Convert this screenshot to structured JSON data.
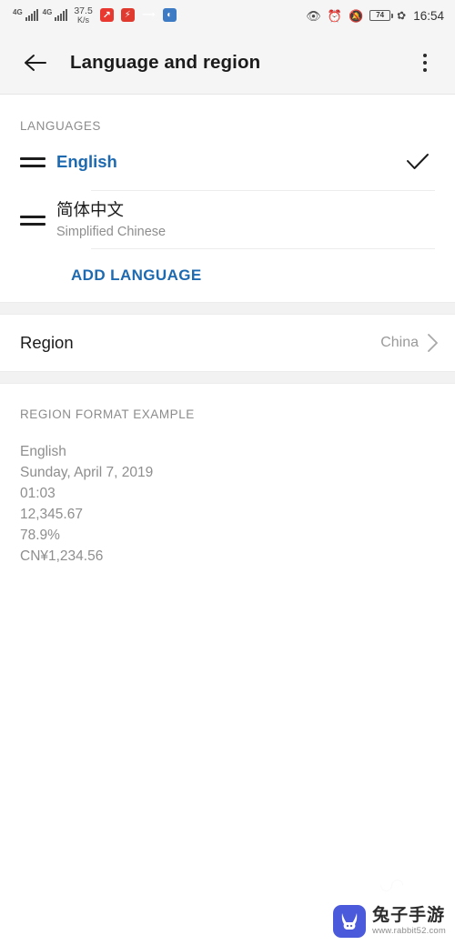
{
  "statusbar": {
    "network_left": [
      {
        "gen": "4G",
        "icon": "signal-bars-icon"
      },
      {
        "gen": "4G",
        "icon": "signal-bars-icon"
      }
    ],
    "net_speed_value": "37.5",
    "net_speed_unit": "K/s",
    "app_icons": [
      "stock-chart-red-icon",
      "stock-alert-red-icon",
      "trend-arrow-red-icon",
      "analytics-blue-icon"
    ],
    "right_icons": [
      "eye-care-icon",
      "alarm-clock-icon",
      "mute-bell-icon"
    ],
    "battery_level": "74",
    "power_saving_icon": "leaf-icon",
    "clock": "16:54"
  },
  "appbar": {
    "back_icon": "back-arrow-icon",
    "title": "Language and region",
    "overflow_icon": "more-vertical-icon"
  },
  "languages_section": {
    "header": "LANGUAGES",
    "items": [
      {
        "handle_icon": "drag-handle-icon",
        "primary": "English",
        "sub": "",
        "selected": true,
        "check_icon": "check-icon"
      },
      {
        "handle_icon": "drag-handle-icon",
        "primary": "简体中文",
        "sub": "Simplified Chinese",
        "selected": false,
        "check_icon": ""
      }
    ],
    "add_language_label": "ADD LANGUAGE"
  },
  "region_section": {
    "label": "Region",
    "value": "China",
    "chevron_icon": "chevron-right-icon"
  },
  "format_section": {
    "header": "REGION FORMAT EXAMPLE",
    "lines": [
      "English",
      "Sunday, April 7, 2019",
      "01:03",
      "12,345.67",
      "78.9%",
      "CN¥1,234.56"
    ]
  },
  "watermark": {
    "logo_icon": "rabbit-logo-icon",
    "name": "兔子手游",
    "url": "www.rabbit52.com"
  },
  "colors": {
    "accent_blue": "#1e6ab0",
    "text_primary": "#1b1b1b",
    "text_secondary": "#8e8e8e",
    "chrome_bg": "#f5f5f5",
    "separator": "#f2f2f2"
  }
}
